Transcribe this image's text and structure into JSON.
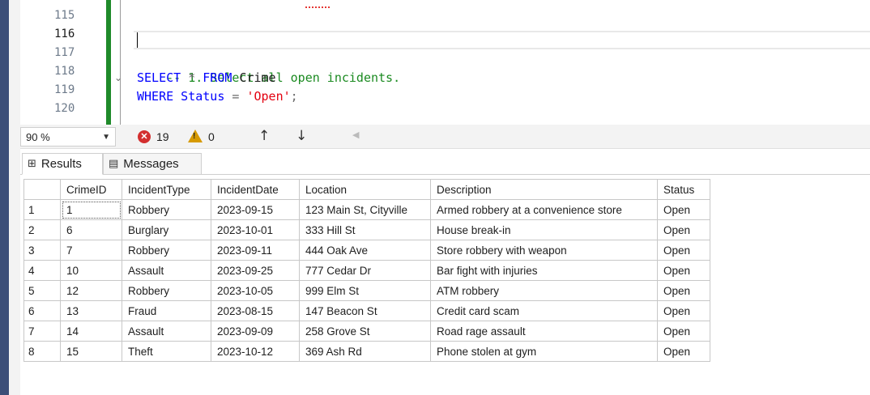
{
  "editor": {
    "line_numbers": [
      "115",
      "116",
      "117",
      "118",
      "119",
      "120"
    ],
    "current_line": "116",
    "code": {
      "comment": "-- 1. Select all open incidents.",
      "line118": {
        "kw1": "SELECT",
        "op": " * ",
        "kw2": "FROM",
        "ident": " Crime"
      },
      "line119": {
        "kw": "WHERE",
        "ident": " Status",
        "op": " = ",
        "str": "'Open'",
        "end": ";"
      }
    }
  },
  "toolbar": {
    "zoom": "90 %",
    "error_count": "19",
    "warning_count": "0",
    "up_arrow": "↑",
    "down_arrow": "↓",
    "left_arrow": "◀"
  },
  "tabs": [
    {
      "label": "Results",
      "icon": "grid-icon",
      "active": true
    },
    {
      "label": "Messages",
      "icon": "messages-icon",
      "active": false
    }
  ],
  "results": {
    "columns": [
      "CrimeID",
      "IncidentType",
      "IncidentDate",
      "Location",
      "Description",
      "Status"
    ],
    "rows": [
      {
        "n": "1",
        "cells": [
          "1",
          "Robbery",
          "2023-09-15",
          "123 Main St, Cityville",
          "Armed robbery at a convenience store",
          "Open"
        ]
      },
      {
        "n": "2",
        "cells": [
          "6",
          "Burglary",
          "2023-10-01",
          "333 Hill St",
          "House break-in",
          "Open"
        ]
      },
      {
        "n": "3",
        "cells": [
          "7",
          "Robbery",
          "2023-09-11",
          "444 Oak Ave",
          "Store robbery with weapon",
          "Open"
        ]
      },
      {
        "n": "4",
        "cells": [
          "10",
          "Assault",
          "2023-09-25",
          "777 Cedar Dr",
          "Bar fight with injuries",
          "Open"
        ]
      },
      {
        "n": "5",
        "cells": [
          "12",
          "Robbery",
          "2023-10-05",
          "999 Elm St",
          "ATM robbery",
          "Open"
        ]
      },
      {
        "n": "6",
        "cells": [
          "13",
          "Fraud",
          "2023-08-15",
          "147 Beacon St",
          "Credit card scam",
          "Open"
        ]
      },
      {
        "n": "7",
        "cells": [
          "14",
          "Assault",
          "2023-09-09",
          "258 Grove St",
          "Road rage assault",
          "Open"
        ]
      },
      {
        "n": "8",
        "cells": [
          "15",
          "Theft",
          "2023-10-12",
          "369 Ash Rd",
          "Phone stolen at gym",
          "Open"
        ]
      }
    ]
  },
  "colors": {
    "keyword": "#0000ff",
    "comment": "#1a8a20",
    "string": "#e3000f",
    "change_bar": "#1f8a2a",
    "error": "#d32f2f",
    "warning": "#d79a00"
  }
}
